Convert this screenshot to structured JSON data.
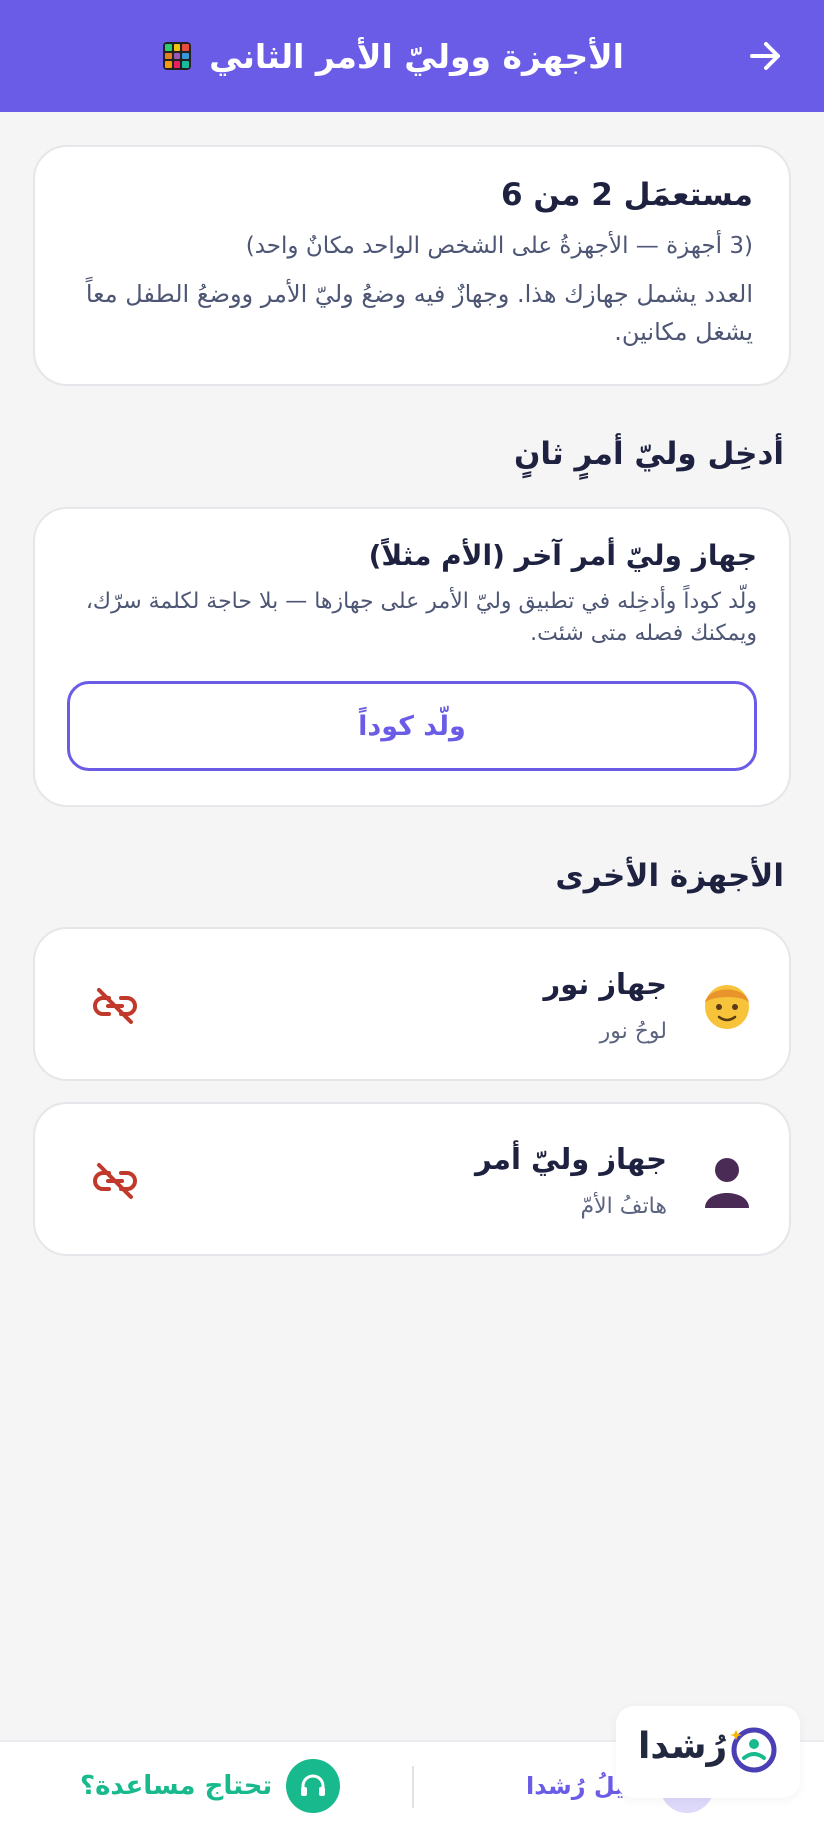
{
  "header": {
    "title": "الأجهزة ووليّ الأمر الثاني",
    "icon": "grid-app-icon",
    "back_icon": "arrow-right-icon",
    "background": "#6b5ce7"
  },
  "usage": {
    "title": "مستعمَل 2 من 6",
    "subtitle": "(3 أجهزة — الأجهزةُ على الشخص الواحد مكانٌ واحد)",
    "note": "العدد يشمل جهازك هذا. وجهازٌ فيه وضعُ وليّ الأمر ووضعُ الطفل معاً يشغل مكانين."
  },
  "invite_section": {
    "title": "أدخِل وليّ أمرٍ ثانٍ",
    "card_title": "جهاز وليّ أمر آخر (الأم مثلاً)",
    "card_desc": "ولّد كوداً وأدخِله في تطبيق وليّ الأمر على جهازها — بلا حاجة لكلمة سرّك، ويمكنك فصله متى شئت.",
    "button_label": "ولّد كوداً"
  },
  "devices_section": {
    "title": "الأجهزة الأخرى",
    "items": [
      {
        "name": "جهاز نور",
        "type": "لوحُ نور",
        "avatar": "child-face-icon",
        "action_icon": "unlink-icon"
      },
      {
        "name": "جهاز وليّ أمر",
        "type": "هاتفُ الأمّ",
        "avatar": "person-silhouette-icon",
        "action_icon": "unlink-icon"
      }
    ]
  },
  "bottom_bar": {
    "help_label": "تحتاج مساعدة؟",
    "help_icon": "headphones-icon",
    "guide_label": "دليلُ رُشدا",
    "guide_icon": "book-icon"
  },
  "brand": {
    "name": "رُشدا",
    "logo": "rushda-logo-icon"
  },
  "colors": {
    "accent": "#6b5ce7",
    "help": "#18b98c",
    "danger": "#c0392b"
  }
}
